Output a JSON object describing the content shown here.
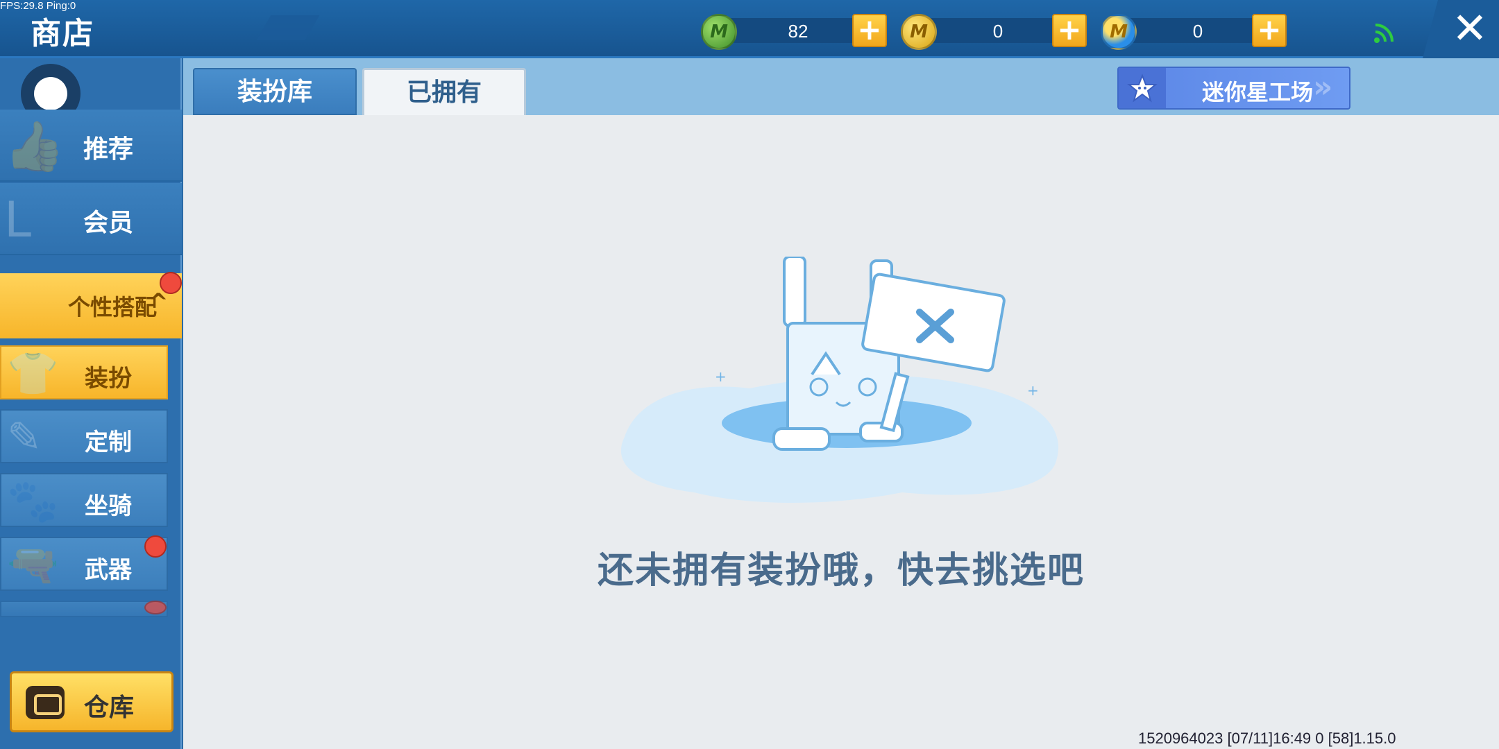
{
  "debug": {
    "fps_text": "FPS:29.8  Ping:0"
  },
  "header": {
    "title": "商店",
    "currencies": [
      {
        "icon": "green-m-coin-icon",
        "letter": "M",
        "amount": "82",
        "color": "#5bb53a"
      },
      {
        "icon": "gold-m-coin-icon",
        "letter": "M",
        "amount": "0",
        "color": "#f2c12e"
      },
      {
        "icon": "blue-m-coin-icon",
        "letter": "M",
        "amount": "0",
        "color": "#2a8ee8"
      }
    ],
    "add_label": "+",
    "close_label": "✕"
  },
  "sidebar": {
    "items": [
      {
        "label": "推荐",
        "icon": "thumbs-up-icon",
        "glyph": "👍"
      },
      {
        "label": "会员",
        "icon": "vip-badge-icon",
        "glyph": "L"
      }
    ],
    "group": {
      "label": "个性搭配",
      "chevron": "^"
    },
    "sub_items": [
      {
        "label": "装扮",
        "icon": "shirt-icon",
        "glyph": "👕",
        "active": true
      },
      {
        "label": "定制",
        "icon": "pencil-icon",
        "glyph": "✎"
      },
      {
        "label": "坐骑",
        "icon": "mount-icon",
        "glyph": "🐾"
      },
      {
        "label": "武器",
        "icon": "gun-icon",
        "glyph": "🔫"
      }
    ],
    "warehouse_label": "仓库"
  },
  "tabs": [
    {
      "label": "装扮库",
      "active": false
    },
    {
      "label": "已拥有",
      "active": true
    }
  ],
  "workshop_label": "迷你星工场",
  "workshop_arrows": "»",
  "empty_message": "还未拥有装扮哦，快去挑选吧",
  "footer": {
    "info": "1520964023   [07/11]16:49 0    [58]1.15.0"
  },
  "colors": {
    "accent_yellow": "#f7b52a",
    "primary_blue": "#2d6fae",
    "notification_red": "#ef4a3d"
  }
}
